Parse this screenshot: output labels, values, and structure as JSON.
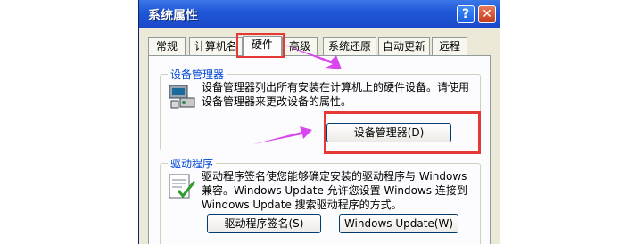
{
  "window": {
    "title": "系统属性",
    "help_label": "?",
    "close_label": "✕"
  },
  "tabs": [
    {
      "label": "常规"
    },
    {
      "label": "计算机名"
    },
    {
      "label": "硬件",
      "active": true
    },
    {
      "label": "高级"
    },
    {
      "label": "系统还原"
    },
    {
      "label": "自动更新"
    },
    {
      "label": "远程"
    }
  ],
  "device_manager": {
    "group_label": "设备管理器",
    "description": "设备管理器列出所有安装在计算机上的硬件设备。请使用设备管理器来更改设备的属性。",
    "button_label": "设备管理器(D)",
    "icon": "device-manager-icon"
  },
  "drivers": {
    "group_label": "驱动程序",
    "description": "驱动程序签名使您能够确定安装的驱动程序与 Windows 兼容。Windows Update 允许您设置 Windows 连接到 Windows Update 搜索驱动程序的方式。",
    "signing_button_label": "驱动程序签名(S)",
    "update_button_label": "Windows Update(W)",
    "icon": "driver-signing-icon"
  },
  "annotation_color": "#e53935",
  "arrow_color": "#d946ef"
}
